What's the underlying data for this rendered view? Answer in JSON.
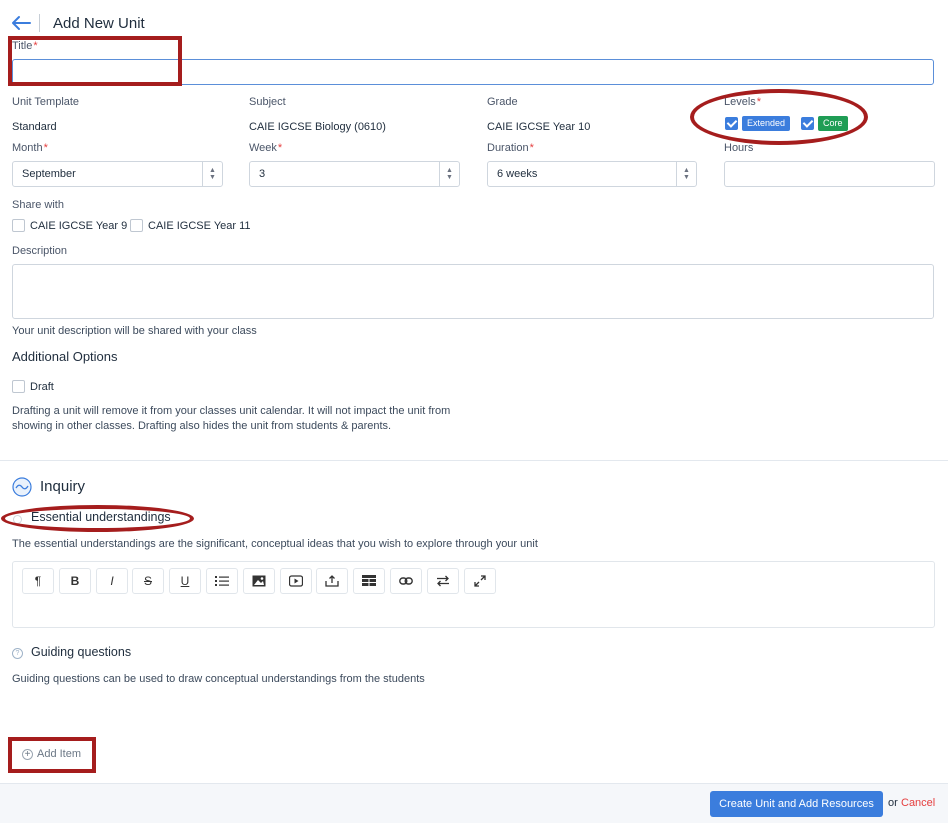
{
  "header": {
    "back_icon": "arrow-left-icon",
    "title": "Add New Unit"
  },
  "form": {
    "title_label": "Title",
    "title_value": "",
    "required_mark": "*",
    "unit_template": {
      "label": "Unit Template",
      "value": "Standard"
    },
    "subject": {
      "label": "Subject",
      "value": "CAIE IGCSE Biology (0610)"
    },
    "grade": {
      "label": "Grade",
      "value": "CAIE IGCSE Year 10"
    },
    "levels": {
      "label": "Levels",
      "items": [
        {
          "label": "Extended",
          "checked": true,
          "color": "#3b7ddd"
        },
        {
          "label": "Core",
          "checked": true,
          "color": "#1f9d55"
        }
      ]
    },
    "month": {
      "label": "Month",
      "value": "September"
    },
    "week": {
      "label": "Week",
      "value": "3"
    },
    "duration": {
      "label": "Duration",
      "value": "6 weeks"
    },
    "hours": {
      "label": "Hours",
      "value": ""
    },
    "share_with": {
      "label": "Share with",
      "items": [
        {
          "label": "CAIE IGCSE Year 9",
          "checked": false
        },
        {
          "label": "CAIE IGCSE Year 11",
          "checked": false
        }
      ]
    },
    "description": {
      "label": "Description",
      "value": "",
      "help": "Your unit description will be shared with your class"
    },
    "additional_options": {
      "heading": "Additional Options",
      "draft_label": "Draft",
      "draft_help_line1": "Drafting a unit will remove it from your classes unit calendar. It will not impact the unit from",
      "draft_help_line2": "showing in other classes. Drafting also hides the unit from students & parents."
    }
  },
  "inquiry": {
    "heading": "Inquiry",
    "essential": {
      "title": "Essential understandings",
      "help": "The essential understandings are the significant, conceptual ideas that you wish to explore through your unit"
    },
    "toolbar": [
      "paragraph-icon",
      "bold-icon",
      "italic-icon",
      "strikethrough-icon",
      "underline-icon",
      "list-icon",
      "image-icon",
      "video-icon",
      "embed-icon",
      "table-icon",
      "link-icon",
      "swap-icon",
      "expand-icon"
    ],
    "guiding": {
      "title": "Guiding questions",
      "help": "Guiding questions can be used to draw conceptual understandings from the students"
    },
    "add_item": "Add Item"
  },
  "footer": {
    "primary_button": "Create Unit and Add Resources",
    "or_text": "or",
    "cancel_link": "Cancel"
  },
  "colors": {
    "accent": "#3b7ddd",
    "danger": "#e53e3e",
    "annotation": "#a51d1d"
  }
}
